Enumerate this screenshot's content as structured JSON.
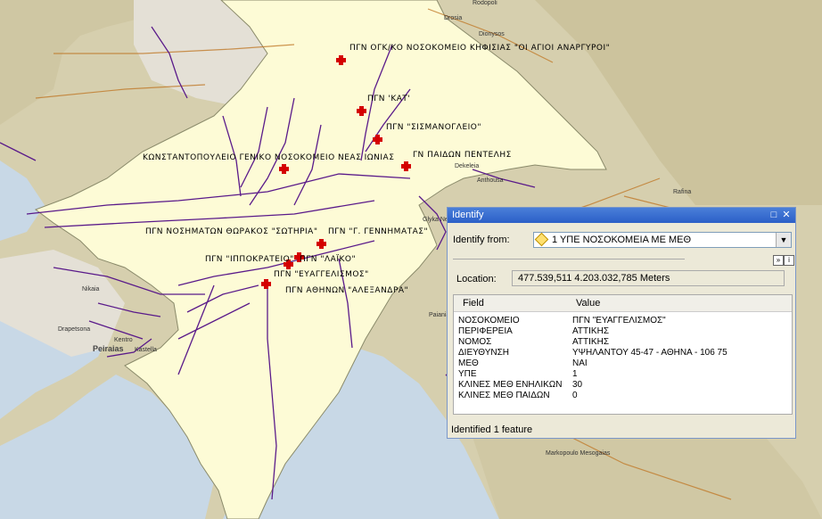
{
  "map": {
    "hospitals": [
      {
        "label": "ΠΓΝ ΟΓΚ/ΚΟ ΝΟΣΟΚΟΜΕΙΟ ΚΗΦΙΣΙΑΣ \"ΟΙ ΑΓΙΟΙ ΑΝΑΡΓΥΡΟΙ\""
      },
      {
        "label": "ΠΓΝ 'ΚΑΤ'"
      },
      {
        "label": "ΠΓΝ \"ΣΙΣΜΑΝΟΓΛΕΙΟ\""
      },
      {
        "label": "ΓΝ ΠΑΙΔΩΝ ΠΕΝΤΕΛΗΣ"
      },
      {
        "label": "ΚΩΝΣΤΑΝΤΟΠΟΥΛΕΙΟ ΓΕΝΙΚΟ ΝΟΣΟΚΟΜΕΙΟ ΝΕΑΣ ΙΩΝΙΑΣ"
      },
      {
        "label": "ΠΓΝ ΝΟΣΗΜΑΤΩΝ ΘΩΡΑΚΟΣ \"ΣΩΤΗΡΙΑ\""
      },
      {
        "label": "ΠΓΝ \"Γ. ΓΕΝΝΗΜΑΤΑΣ\""
      },
      {
        "label": "ΠΓΝ \"ΙΠΠΟΚΡΑΤΕΙΟ\""
      },
      {
        "label": "ΠΓΝ \"ΛΑΪΚΟ\""
      },
      {
        "label": "ΠΓΝ \"ΕΥΑΓΓΕΛΙΣΜΟΣ\""
      },
      {
        "label": "ΠΓΝ ΑΘΗΝΩΝ \"ΑΛΕΞΑΝΔΡΑ\""
      }
    ],
    "places": [
      "Nikaia",
      "Peiraias",
      "Kastella",
      "Rafina",
      "Anthousa",
      "Dionysos",
      "Drosia",
      "Rodopoli",
      "Markopoulo Mesogaias",
      "Paiania",
      "Dekeleia",
      "Glyka Nera",
      "Drapetsona",
      "Kentro"
    ]
  },
  "identify": {
    "title": "Identify",
    "from_label": "Identify from:",
    "layer": "1 ΥΠΕ ΝΟΣΟΚΟΜΕΙΑ ΜΕ ΜΕΘ",
    "location_label": "Location:",
    "location_value": "477.539,511  4.203.032,785 Meters",
    "col_field": "Field",
    "col_value": "Value",
    "rows": [
      {
        "field": "ΝΟΣΟΚΟΜΕΙΟ",
        "value": "ΠΓΝ \"ΕΥΑΓΓΕΛΙΣΜΟΣ\""
      },
      {
        "field": "ΠΕΡΙΦΕΡΕΙΑ",
        "value": "ΑΤΤΙΚΗΣ"
      },
      {
        "field": "ΝΟΜΟΣ",
        "value": "ΑΤΤΙΚΗΣ"
      },
      {
        "field": "ΔΙΕΥΘΥΝΣΗ",
        "value": "ΥΨΗΛΑΝΤΟΥ 45-47 - ΑΘΗΝΑ - 106 75"
      },
      {
        "field": "ΜΕΘ",
        "value": "ΝΑΙ"
      },
      {
        "field": "ΥΠΕ",
        "value": "1"
      },
      {
        "field": "ΚΛΙΝΕΣ ΜΕΘ ΕΝΗΛΙΚΩΝ",
        "value": "30"
      },
      {
        "field": "ΚΛΙΝΕΣ ΜΕΘ ΠΑΙΔΩΝ",
        "value": "0"
      }
    ],
    "status": "Identified 1 feature"
  }
}
